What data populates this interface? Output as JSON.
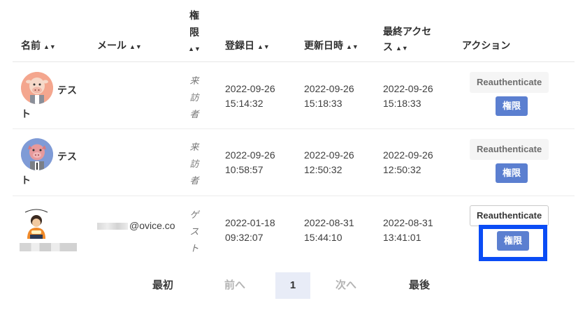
{
  "columns": {
    "name": "名前",
    "email": "メール",
    "role_chars": [
      "権",
      "限"
    ],
    "registered": "登録日",
    "updated": "更新日時",
    "last_access_line1": "最終アクセ",
    "last_access_line2": "ス",
    "actions": "アクション",
    "sort_icon": "sort-icon"
  },
  "rows": [
    {
      "avatar": "cow-avatar",
      "name_line1": "テス",
      "name_line2": "ト",
      "email": "",
      "role_chars": [
        "来",
        "訪",
        "者"
      ],
      "registered": "2022-09-26\n15:14:32",
      "updated": "2022-09-26\n15:18:33",
      "last_access": "2022-09-26\n15:18:33",
      "reauth_label": "Reauthenticate",
      "perm_label": "権限"
    },
    {
      "avatar": "pig-avatar",
      "name_line1": "テス",
      "name_line2": "ト",
      "email": "",
      "role_chars": [
        "来",
        "訪",
        "者"
      ],
      "registered": "2022-09-26\n10:58:57",
      "updated": "2022-09-26\n12:50:32",
      "last_access": "2022-09-26\n12:50:32",
      "reauth_label": "Reauthenticate",
      "perm_label": "権限"
    },
    {
      "avatar": "cartoon-person-avatar",
      "name_line1": "",
      "name_line2": "",
      "email_domain": "@ovice.co",
      "role_chars": [
        "ゲ",
        "ス",
        "ト"
      ],
      "registered": "2022-01-18\n09:32:07",
      "updated": "2022-08-31\n15:44:10",
      "last_access": "2022-08-31\n13:41:01",
      "reauth_label": "Reauthenticate",
      "perm_label": "権限"
    }
  ],
  "pagination": {
    "first": "最初",
    "prev": "前へ",
    "current": "1",
    "next": "次へ",
    "last": "最後"
  },
  "colors": {
    "accent": "#5b7fd0",
    "focus_outline": "#0a4cf5",
    "active_page_bg": "#e8ecf7"
  }
}
